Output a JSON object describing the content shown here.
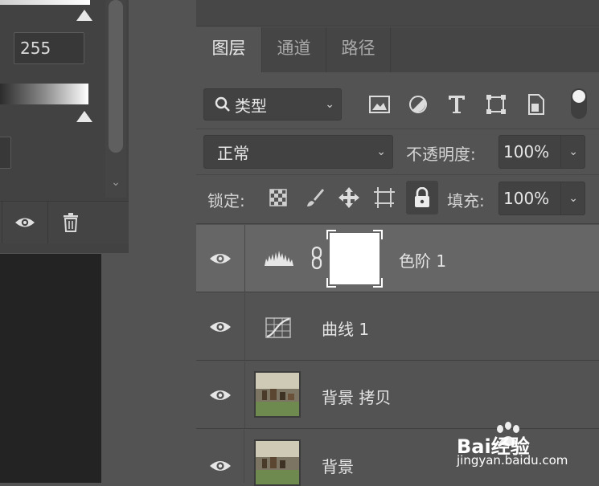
{
  "left_panel": {
    "input_white_value": "255"
  },
  "layers_panel": {
    "tabs": [
      {
        "label": "图层",
        "active": true
      },
      {
        "label": "通道",
        "active": false
      },
      {
        "label": "路径",
        "active": false
      }
    ],
    "filter": {
      "kind_label": "类型"
    },
    "blend_mode": "正常",
    "opacity": {
      "label": "不透明度:",
      "value": "100%"
    },
    "lock": {
      "label": "锁定:"
    },
    "fill": {
      "label": "填充:",
      "value": "100%"
    },
    "layers": [
      {
        "name": "色阶 1",
        "type": "levels-adjustment",
        "visible": true,
        "selected": true
      },
      {
        "name": "曲线 1",
        "type": "curves-adjustment",
        "visible": true,
        "selected": false
      },
      {
        "name": "背景 拷贝",
        "type": "image",
        "visible": true,
        "selected": false
      },
      {
        "name": "背景",
        "type": "image",
        "visible": true,
        "selected": false
      }
    ]
  },
  "watermark": {
    "brand": "Bai经验",
    "url": "jingyan.baidu.com"
  },
  "colors": {
    "panel_bg": "#535353",
    "selected_row": "#666666",
    "canvas_bg": "#232323"
  }
}
